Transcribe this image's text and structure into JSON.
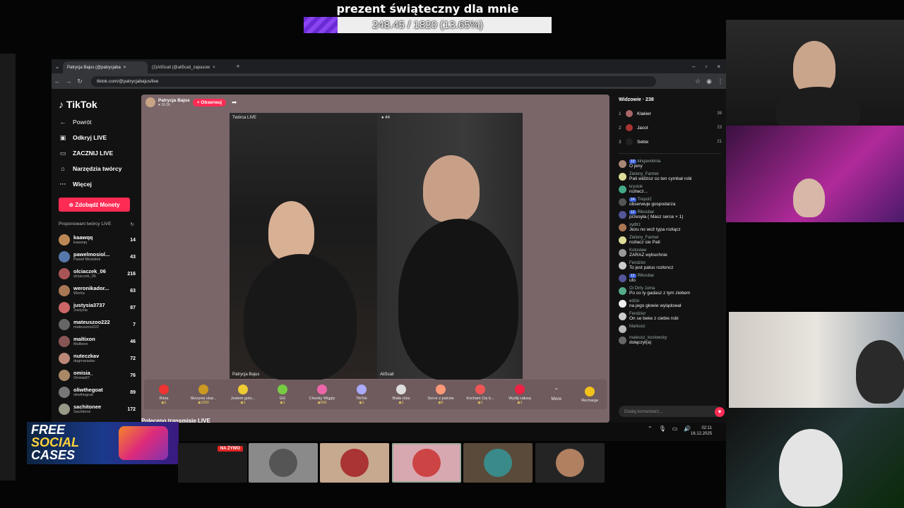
{
  "goal": {
    "title": "prezent świąteczny dla mnie",
    "progress_text": "248.45 / 1820 (13.65%)",
    "progress_fraction": 0.1365
  },
  "browser": {
    "tabs": [
      {
        "label": "Patrycja Bajus (@patrycjaba"
      },
      {
        "label": "(2)AliScali (@ali5cali_zapasow"
      }
    ],
    "url": "tiktok.com/@patrycjabajus/live"
  },
  "sidebar": {
    "logo": "TikTok",
    "back": "Powrót",
    "items": [
      "Odkryj LIVE",
      "ZACZNIJ LIVE",
      "Narzędzia twórcy",
      "Więcej"
    ],
    "coins_button": "Zdobądź Monety",
    "suggested_header": "Proponowani twórcy LIVE",
    "creators": [
      {
        "name": "kaawqq",
        "sub": "kaawqq",
        "count": "14",
        "color": "#b85"
      },
      {
        "name": "pawelmosiol...",
        "sub": "Paweł Mosiołek",
        "count": "43",
        "color": "#57a"
      },
      {
        "name": "olciaczek_06",
        "sub": "olciaczek_06",
        "count": "216",
        "color": "#a55"
      },
      {
        "name": "weronikador...",
        "sub": "Werka",
        "count": "63",
        "color": "#a75"
      },
      {
        "name": "justysia3737",
        "sub": "Justysia",
        "count": "87",
        "color": "#c66"
      },
      {
        "name": "mateuszoo222",
        "sub": "mateuszoo222",
        "count": "7",
        "color": "#666"
      },
      {
        "name": "maltixon",
        "sub": "Maltixon",
        "count": "46",
        "color": "#855"
      },
      {
        "name": "nuteczkav",
        "sub": "dagmaradav",
        "count": "72",
        "color": "#b87"
      },
      {
        "name": "omisia_",
        "sub": "Omisia67",
        "count": "76",
        "color": "#a86"
      },
      {
        "name": "oliwthegoat",
        "sub": "oliwthegoat",
        "count": "89",
        "color": "#777"
      },
      {
        "name": "sachitonee",
        "sub": "Sachitone",
        "count": "172",
        "color": "#998"
      }
    ],
    "previous": "Poleceno transmisje LIVE"
  },
  "stage": {
    "host_name": "Patrycja Bajus",
    "host_likes": "39.3K",
    "follow": "+ Obserwuj",
    "left_label": "Twórca LIVE",
    "left_name": "Patrycja Bajus",
    "right_count": "44",
    "right_name": "AliScali",
    "gifts": [
      {
        "name": "Róża",
        "price": "1",
        "color": "#e33"
      },
      {
        "name": "Skrzynia skar...",
        "price": "1500",
        "color": "#c92"
      },
      {
        "name": "Jestem goto...",
        "price": "1",
        "color": "#ec3"
      },
      {
        "name": "GG",
        "price": "1",
        "color": "#7c4"
      },
      {
        "name": "Cheeky Wiggly",
        "price": "500",
        "color": "#e6a"
      },
      {
        "name": "TikTok",
        "price": "1",
        "color": "#aaf"
      },
      {
        "name": "Biała róża",
        "price": "1",
        "color": "#ddd"
      },
      {
        "name": "Serce z palców",
        "price": "5",
        "color": "#f97"
      },
      {
        "name": "Kocham Cię b...",
        "price": "1",
        "color": "#e55"
      },
      {
        "name": "Wyślij całusa",
        "price": "1",
        "color": "#e24"
      }
    ],
    "more": "More",
    "recharge": "Recharge"
  },
  "chat": {
    "viewers_header": "Widzowie · 238",
    "top_viewers": [
      {
        "rank": "1",
        "name": "Klakier",
        "score": "38",
        "color": "#a66"
      },
      {
        "rank": "2",
        "name": "Jacol",
        "score": "23",
        "color": "#a33"
      },
      {
        "rank": "3",
        "name": "Sebix",
        "score": "21",
        "color": "#222"
      }
    ],
    "messages": [
      {
        "user": "kingaxxkinia",
        "text": "O jeny",
        "badge": "10",
        "color": "#a87"
      },
      {
        "user": "Zielony_Farmer",
        "text": "Pati widzisz co ten cymbał robi",
        "badge": "",
        "color": "#dd9"
      },
      {
        "user": "krystok",
        "text": "rozłacz...",
        "badge": "",
        "color": "#4a8"
      },
      {
        "user": "Trepol2",
        "text": "obserwuje gospodarza",
        "badge": "24",
        "color": "#555"
      },
      {
        "user": "Rikosbar",
        "text": "przesyła ( Masz serce × 1)",
        "badge": "12",
        "color": "#559"
      },
      {
        "user": "xydtrz",
        "text": "Jezu no woź typa rozłącz",
        "badge": "",
        "color": "#a75"
      },
      {
        "user": "Zielony_Farmer",
        "text": "rozłacz sie Pati",
        "badge": "",
        "color": "#dd9"
      },
      {
        "user": "Kotosław",
        "text": "ZARAZ wybuchnie",
        "badge": "",
        "color": "#999"
      },
      {
        "user": "Fendzior",
        "text": "To jest patus rozłoncz",
        "badge": "",
        "color": "#ccc"
      },
      {
        "user": "Rikosbar",
        "text": "ufo",
        "badge": "12",
        "color": "#559"
      },
      {
        "user": "Oi Dirty Juma",
        "text": "Po co ty gadasz z tym ziebem",
        "badge": "",
        "color": "#5a8"
      },
      {
        "user": "edzio",
        "text": "na jego głowie wylądował",
        "badge": "",
        "color": "#eee"
      },
      {
        "user": "Fendzior",
        "text": "On se beke z ciebie robi",
        "badge": "",
        "color": "#ccc"
      },
      {
        "user": "Markusz",
        "text": "",
        "badge": "",
        "color": "#bbb"
      },
      {
        "user": "mateusz_koslowsky",
        "text": "dołączył(a)",
        "badge": "",
        "color": "#666"
      }
    ],
    "input_placeholder": "Dodaj komentarz..."
  },
  "taskbar": {
    "time": "02:11",
    "date": "16.12.2025"
  },
  "bottom": {
    "promo_line1": "FREE",
    "promo_line2": "SOCIAL",
    "promo_line3": "CASES",
    "live_tag": "NA ŻYWO"
  }
}
